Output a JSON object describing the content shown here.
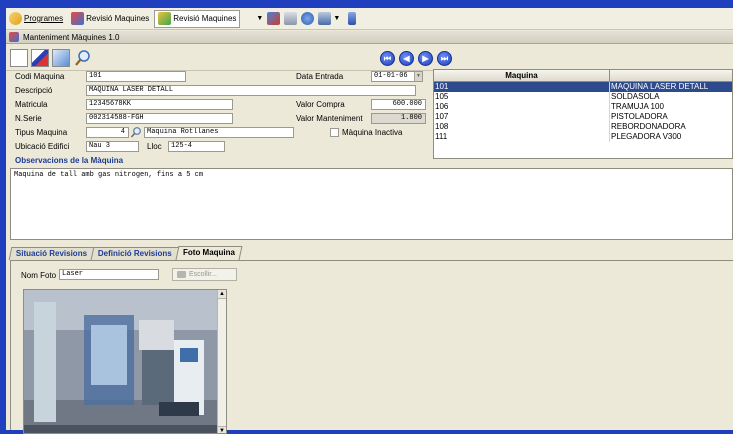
{
  "menubar": {
    "items": [
      {
        "label": "Programes"
      },
      {
        "label": "Revisió Maquines"
      },
      {
        "label": "Revisió Maquines"
      }
    ]
  },
  "window": {
    "title": "Manteniment Màquines 1.0"
  },
  "form": {
    "codi_label": "Codi Maquina",
    "codi_value": "101",
    "descripcio_label": "Descripció",
    "descripcio_value": "MAQUINA LASER DETALL",
    "matricula_label": "Matricula",
    "matricula_value": "12345678KK",
    "nserie_label": "N.Serie",
    "nserie_value": "002314588-FGH",
    "tipus_label": "Tipus Maquina",
    "tipus_value": "4",
    "tipus_desc": "Maquina Rotllanes",
    "ubicacio_label": "Ubicació Edifici",
    "ubicacio_value": "Nau 3",
    "lloc_label": "Lloc",
    "lloc_value": "125-4",
    "data_entrada_label": "Data Entrada",
    "data_entrada_value": "01-01-06",
    "valor_compra_label": "Valor Compra",
    "valor_compra_value": "600.000",
    "valor_manteniment_label": "Valor Manteniment",
    "valor_manteniment_value": "1.800",
    "inactiva_label": "Màquina Inactiva"
  },
  "observacions": {
    "label": "Observacions de la Màquina",
    "text": "Maquina de tall amb gas nitrogen, fins a 5 cm"
  },
  "grid": {
    "header": "Maquina",
    "rows": [
      {
        "code": "101",
        "name": "MAQUINA LASER DETALL"
      },
      {
        "code": "105",
        "name": "SOLDASOLA"
      },
      {
        "code": "106",
        "name": "TRAMUJA 100"
      },
      {
        "code": "107",
        "name": "PISTOLADORA"
      },
      {
        "code": "108",
        "name": "REBORDONADORA"
      },
      {
        "code": "111",
        "name": "PLEGADORA V300"
      }
    ]
  },
  "tabs": [
    {
      "label": "Situació Revisions"
    },
    {
      "label": "Definició Revisions"
    },
    {
      "label": "Foto Maquina"
    }
  ],
  "foto": {
    "nom_label": "Nom Foto",
    "nom_value": "Laser",
    "escollir_label": "Escollir..."
  }
}
